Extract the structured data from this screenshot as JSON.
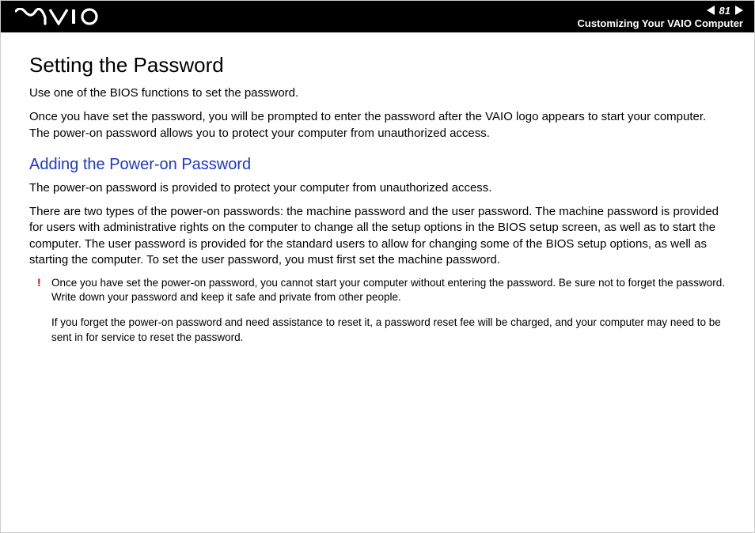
{
  "header": {
    "page_number": "81",
    "breadcrumb": "Customizing Your VAIO Computer"
  },
  "content": {
    "title": "Setting the Password",
    "intro1": "Use one of the BIOS functions to set the password.",
    "intro2": "Once you have set the password, you will be prompted to enter the password after the VAIO logo appears to start your computer. The power-on password allows you to protect your computer from unauthorized access.",
    "subheading": "Adding the Power-on Password",
    "sub_p1": "The power-on password is provided to protect your computer from unauthorized access.",
    "sub_p2": "There are two types of the power-on passwords: the machine password and the user password. The machine password is provided for users with administrative rights on the computer to change all the setup options in the BIOS setup screen, as well as to start the computer. The user password is provided for the standard users to allow for changing some of the BIOS setup options, as well as starting the computer. To set the user password, you must first set the machine password.",
    "warning_mark": "!",
    "warning_p1": "Once you have set the power-on password, you cannot start your computer without entering the password. Be sure not to forget the password. Write down your password and keep it safe and private from other people.",
    "warning_p2": "If you forget the power-on password and need assistance to reset it, a password reset fee will be charged, and your computer may need to be sent in for service to reset the password."
  }
}
